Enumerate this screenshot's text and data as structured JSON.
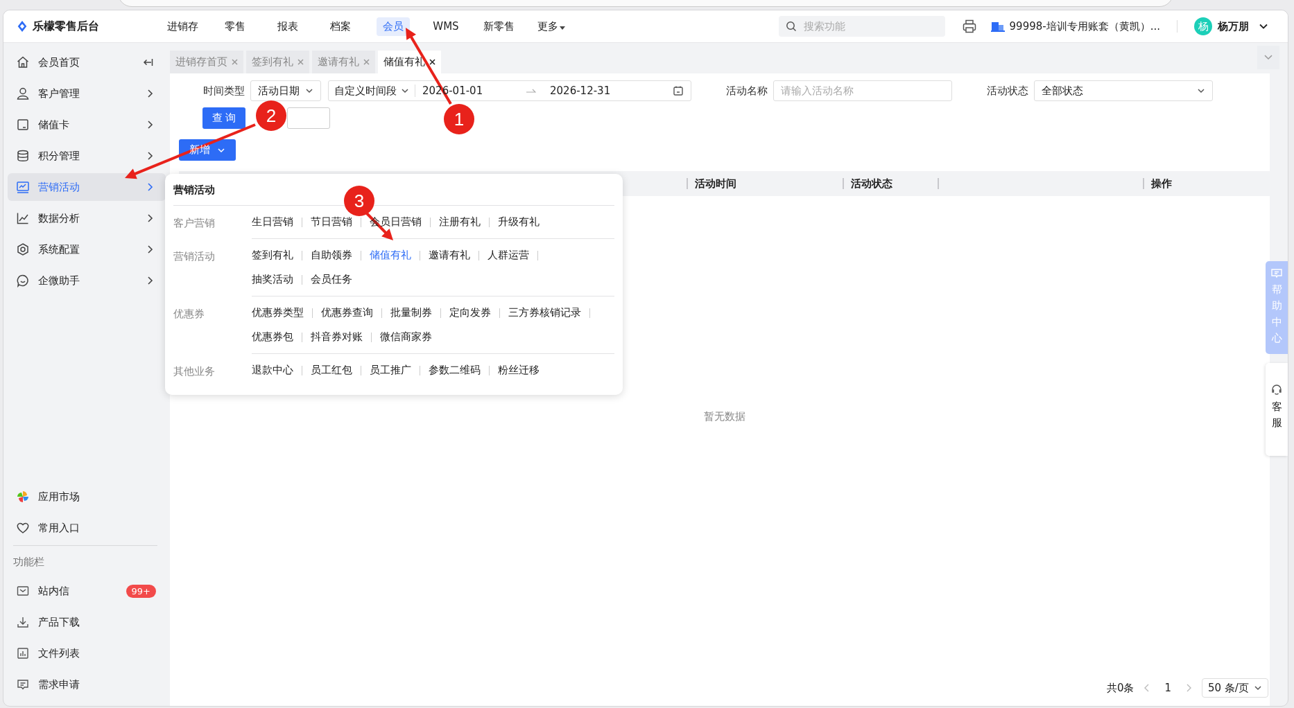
{
  "topbar": {
    "brand": "乐檬零售后台",
    "nav": [
      {
        "label": "进销存",
        "selected": false
      },
      {
        "label": "零售",
        "selected": false
      },
      {
        "label": "报表",
        "selected": false
      },
      {
        "label": "档案",
        "selected": false
      },
      {
        "label": "会员",
        "selected": true
      },
      {
        "label": "WMS",
        "selected": false
      },
      {
        "label": "新零售",
        "selected": false
      },
      {
        "label": "更多",
        "selected": false
      }
    ],
    "search": {
      "placeholder": "搜索功能"
    },
    "account": "99998-培训专用账套（黄凯）...",
    "avatar": "杨",
    "user": "杨万朋"
  },
  "sidebar": {
    "items": [
      {
        "label": "会员首页",
        "selected": false,
        "kind": "collapse"
      },
      {
        "label": "客户管理",
        "selected": false,
        "kind": "expand"
      },
      {
        "label": "储值卡",
        "selected": false,
        "kind": "expand"
      },
      {
        "label": "积分管理",
        "selected": false,
        "kind": "expand"
      },
      {
        "label": "营销活动",
        "selected": true,
        "kind": "expand"
      },
      {
        "label": "数据分析",
        "selected": false,
        "kind": "expand"
      },
      {
        "label": "系统配置",
        "selected": false,
        "kind": "expand"
      },
      {
        "label": "企微助手",
        "selected": false,
        "kind": "expand"
      }
    ],
    "apps": [
      {
        "label": "应用市场"
      },
      {
        "label": "常用入口"
      }
    ],
    "section_title": "功能栏",
    "tools": [
      {
        "label": "站内信",
        "badge": "99+"
      },
      {
        "label": "产品下载"
      },
      {
        "label": "文件列表"
      },
      {
        "label": "需求申请"
      }
    ]
  },
  "tabs": [
    {
      "label": "进销存首页",
      "selected": false
    },
    {
      "label": "签到有礼",
      "selected": false
    },
    {
      "label": "邀请有礼",
      "selected": false
    },
    {
      "label": "储值有礼",
      "selected": true
    }
  ],
  "filters": {
    "time_type_label": "时间类型",
    "time_type": "活动日期",
    "range_mode": "自定义时间段",
    "start_date": "2026-01-01",
    "end_date": "2026-12-31",
    "name_label": "活动名称",
    "name_placeholder": "请输入活动名称",
    "status_label": "活动状态",
    "status": "全部状态"
  },
  "buttons": {
    "query": "查 询",
    "add": "新增"
  },
  "table": {
    "columns": [
      {
        "label": "活动时间"
      },
      {
        "label": "活动状态"
      },
      {
        "label": "操作"
      }
    ],
    "empty": "暂无数据"
  },
  "pagination": {
    "total": "共0条",
    "page": "1",
    "page_size": "50 条/页"
  },
  "float": {
    "help": "帮助中心",
    "service": "客服"
  },
  "menu": {
    "title": "营销活动",
    "groups": [
      {
        "label": "客户营销",
        "rows": [
          [
            {
              "label": "生日营销",
              "selected": false
            },
            {
              "label": "节日营销",
              "selected": false
            },
            {
              "label": "会员日营销",
              "selected": false
            },
            {
              "label": "注册有礼",
              "selected": false
            },
            {
              "label": "升级有礼",
              "selected": false
            }
          ]
        ]
      },
      {
        "label": "营销活动",
        "rows": [
          [
            {
              "label": "签到有礼",
              "selected": false
            },
            {
              "label": "自助领券",
              "selected": false
            },
            {
              "label": "储值有礼",
              "selected": true
            },
            {
              "label": "邀请有礼",
              "selected": false
            },
            {
              "label": "人群运营",
              "selected": false
            }
          ],
          [
            {
              "label": "抽奖活动",
              "selected": false
            },
            {
              "label": "会员任务",
              "selected": false
            }
          ]
        ]
      },
      {
        "label": "优惠券",
        "rows": [
          [
            {
              "label": "优惠券类型",
              "selected": false
            },
            {
              "label": "优惠券查询",
              "selected": false
            },
            {
              "label": "批量制券",
              "selected": false
            },
            {
              "label": "定向发券",
              "selected": false
            },
            {
              "label": "三方券核销记录",
              "selected": false
            }
          ],
          [
            {
              "label": "优惠券包",
              "selected": false
            },
            {
              "label": "抖音券对账",
              "selected": false
            },
            {
              "label": "微信商家券",
              "selected": false
            }
          ]
        ]
      },
      {
        "label": "其他业务",
        "rows": [
          [
            {
              "label": "退款中心",
              "selected": false
            },
            {
              "label": "员工红包",
              "selected": false
            },
            {
              "label": "员工推广",
              "selected": false
            },
            {
              "label": "参数二维码",
              "selected": false
            },
            {
              "label": "粉丝迁移",
              "selected": false
            }
          ]
        ]
      }
    ]
  },
  "annotations": [
    {
      "number": "1"
    },
    {
      "number": "2"
    },
    {
      "number": "3"
    }
  ]
}
